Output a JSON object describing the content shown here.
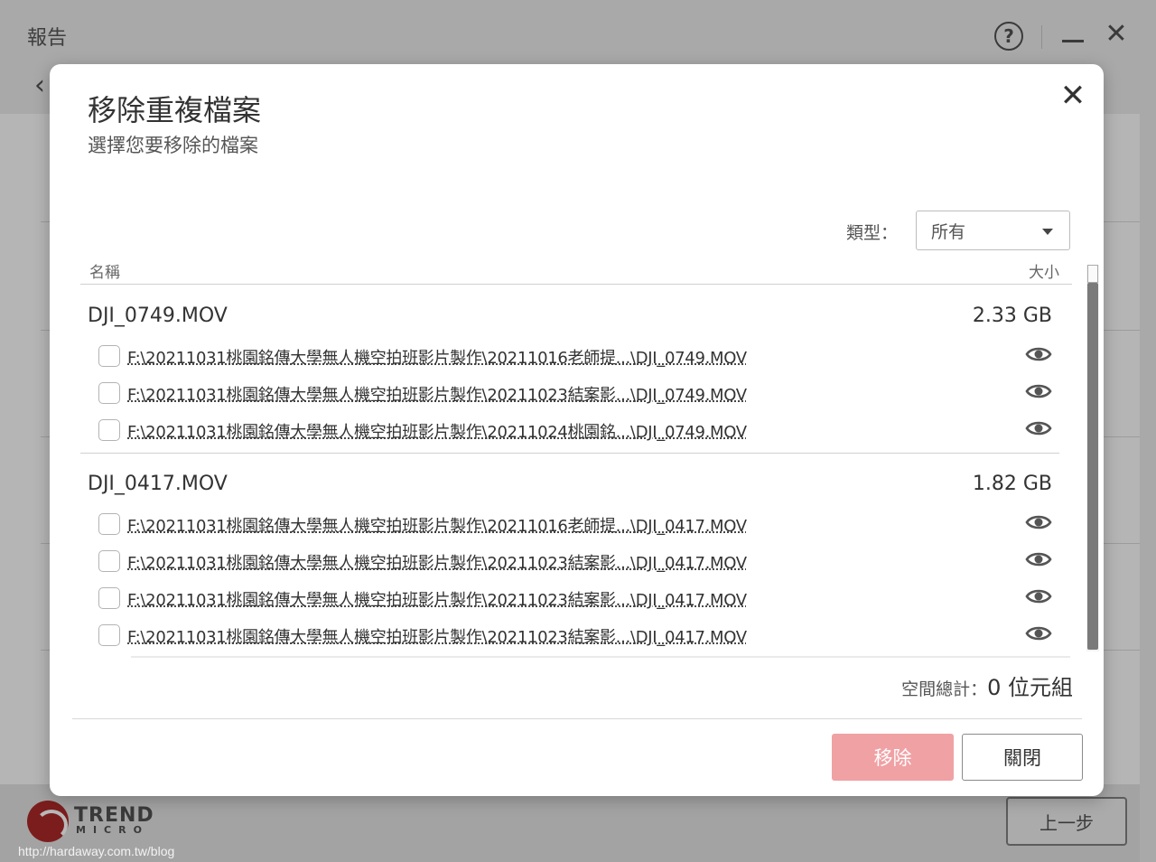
{
  "app": {
    "title": "報告",
    "help_glyph": "?",
    "prev_button": "上一步",
    "logo_text": "TREND",
    "logo_sub": "MICRO",
    "watermark": "http://hardaway.com.tw/blog"
  },
  "dialog": {
    "title": "移除重複檔案",
    "subtitle": "選擇您要移除的檔案",
    "type_label": "類型：",
    "type_selected": "所有",
    "col_name": "名稱",
    "col_size": "大小",
    "groups": [
      {
        "name": "DJI_0749.MOV",
        "size": "2.33 GB",
        "files": [
          {
            "path": "F:\\20211031桃園銘傳大學無人機空拍班影片製作\\20211016老師提...\\DJI_0749.MOV",
            "checked": false
          },
          {
            "path": "F:\\20211031桃園銘傳大學無人機空拍班影片製作\\20211023結案影...\\DJI_0749.MOV",
            "checked": false
          },
          {
            "path": "F:\\20211031桃園銘傳大學無人機空拍班影片製作\\20211024桃園銘...\\DJI_0749.MOV",
            "checked": false
          }
        ]
      },
      {
        "name": "DJI_0417.MOV",
        "size": "1.82 GB",
        "files": [
          {
            "path": "F:\\20211031桃園銘傳大學無人機空拍班影片製作\\20211016老師提...\\DJI_0417.MOV",
            "checked": false
          },
          {
            "path": "F:\\20211031桃園銘傳大學無人機空拍班影片製作\\20211023結案影...\\DJI_0417.MOV",
            "checked": false
          },
          {
            "path": "F:\\20211031桃園銘傳大學無人機空拍班影片製作\\20211023結案影...\\DJI_0417.MOV",
            "checked": false
          },
          {
            "path": "F:\\20211031桃園銘傳大學無人機空拍班影片製作\\20211023結案影...\\DJI_0417.MOV",
            "checked": false
          }
        ]
      }
    ],
    "total_label": "空間總計：",
    "total_value": "0 位元組",
    "remove_button": "移除",
    "close_button": "關閉"
  },
  "colors": {
    "remove_button": "#f0a1a4",
    "overlay": "#a9a9a9"
  },
  "icons": {
    "dialog_close": "close-icon",
    "preview": "eye-icon",
    "dropdown": "chevron-down-icon"
  }
}
